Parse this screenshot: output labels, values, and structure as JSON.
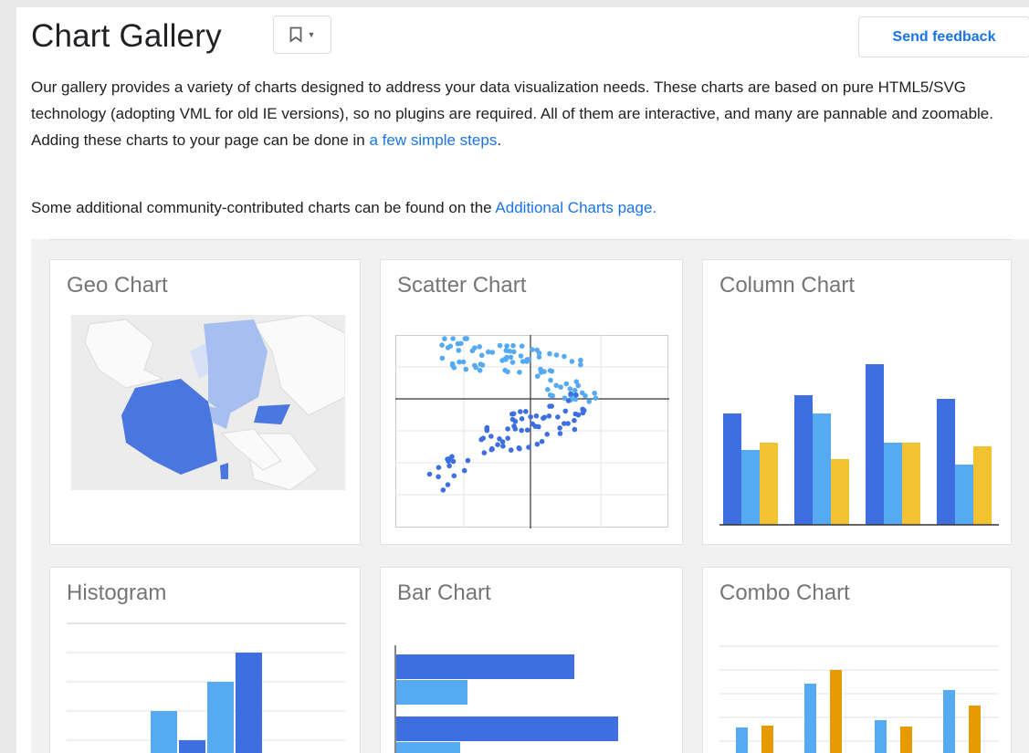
{
  "header": {
    "title": "Chart Gallery",
    "feedback_label": "Send feedback"
  },
  "intro": {
    "line1": "Our gallery provides a variety of charts designed to address your data visualization needs. These charts are based on pure HTML5/SVG technology (adopting VML for old IE versions), so no plugins are required. All of them are interactive, and many are pannable and zoomable. Adding these charts to your page can be done in ",
    "line1_link": "a few simple steps",
    "line1_end": ".",
    "line2": "Some additional community-contributed charts can be found on the ",
    "line2_link": "Additional Charts page."
  },
  "gallery": {
    "cards": [
      {
        "label": "Geo Chart"
      },
      {
        "label": "Scatter Chart"
      },
      {
        "label": "Column Chart"
      },
      {
        "label": "Histogram"
      },
      {
        "label": "Bar Chart"
      },
      {
        "label": "Combo Chart"
      }
    ]
  },
  "colors": {
    "blue_dark": "#3d6fe0",
    "blue_light": "#55aaf2",
    "yellow": "#f1c232",
    "orange": "#e69a00",
    "link": "#1a73e8"
  }
}
